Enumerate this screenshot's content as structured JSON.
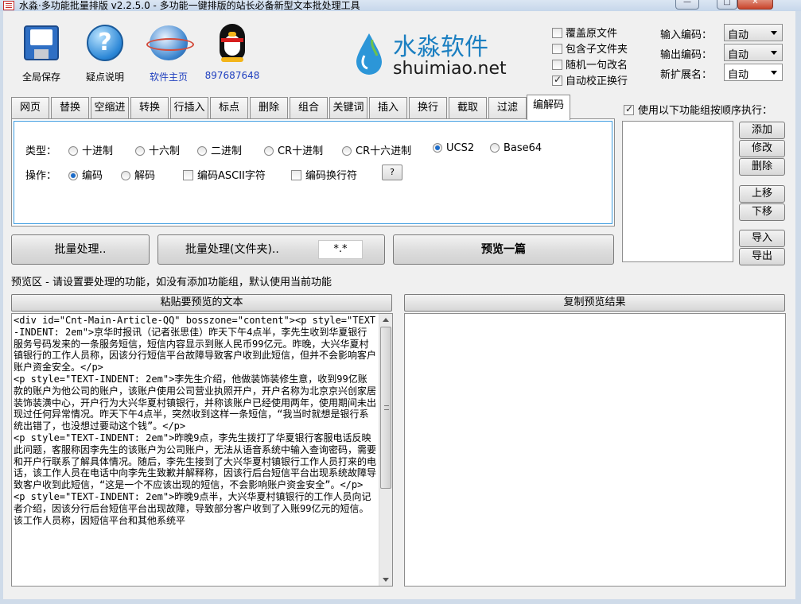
{
  "window": {
    "title": "水淼·多功能批量排版 v2.2.5.0 - 多功能一键排版的站长必备新型文本批处理工具"
  },
  "toolbar": [
    {
      "label": "全局保存",
      "icon": "floppy-disk-icon"
    },
    {
      "label": "疑点说明",
      "icon": "help-icon"
    },
    {
      "label": "软件主页",
      "icon": "globe-icon"
    },
    {
      "label": "897687648",
      "icon": "qq-penguin-icon"
    }
  ],
  "logo": {
    "brand": "水淼软件",
    "domain": "shuimiao.net"
  },
  "options": [
    {
      "label": "覆盖原文件",
      "checked": false
    },
    {
      "label": "包含子文件夹",
      "checked": false
    },
    {
      "label": "随机一句改名",
      "checked": false
    },
    {
      "label": "自动校正换行",
      "checked": true
    }
  ],
  "encoding": {
    "input_label": "输入编码：",
    "input_value": "自动",
    "output_label": "输出编码：",
    "output_value": "自动",
    "ext_label": "新扩展名：",
    "ext_value": "自动"
  },
  "tabs": [
    "网页",
    "替换",
    "空缩进",
    "转换",
    "行插入",
    "标点",
    "删除",
    "组合",
    "关键词",
    "插入",
    "换行",
    "截取",
    "过滤",
    "编解码"
  ],
  "active_tab": "编解码",
  "codec": {
    "type_label": "类型：",
    "types": [
      {
        "label": "十进制",
        "selected": false
      },
      {
        "label": "十六制",
        "selected": false
      },
      {
        "label": "二进制",
        "selected": false
      },
      {
        "label": "CR十进制",
        "selected": false
      },
      {
        "label": "CR十六进制",
        "selected": false
      },
      {
        "label": "UCS2",
        "selected": true
      },
      {
        "label": "Base64",
        "selected": false
      }
    ],
    "op_label": "操作：",
    "ops": [
      {
        "label": "编码",
        "selected": true
      },
      {
        "label": "解码",
        "selected": false
      }
    ],
    "checks": [
      {
        "label": "编码ASCII字符",
        "checked": false
      },
      {
        "label": "编码换行符",
        "checked": false
      }
    ],
    "help_button": "?"
  },
  "actions": {
    "batch": "批量处理..",
    "batch_folder": "批量处理(文件夹)..",
    "mask": "*.*",
    "preview": "预览一篇"
  },
  "sequence": {
    "header": "使用以下功能组按顺序执行：",
    "checked": true,
    "buttons": [
      "添加",
      "修改",
      "删除",
      "上移",
      "下移",
      "导入",
      "导出"
    ]
  },
  "preview": {
    "note": "预览区 - 请设置要处理的功能，如没有添加功能组，默认使用当前功能",
    "paste_button": "粘贴要预览的文本",
    "copy_button": "复制预览结果",
    "source_text": "<div id=\"Cnt-Main-Article-QQ\" bosszone=\"content\"><p style=\"TEXT-INDENT: 2em\">京华时报讯（记者张思佳）昨天下午4点半，李先生收到华夏银行服务号码发来的一条服务短信，短信内容显示到账人民币99亿元。昨晚，大兴华夏村镇银行的工作人员称，因该分行短信平台故障导致客户收到此短信，但并不会影响客户账户资金安全。</p>\n<p style=\"TEXT-INDENT: 2em\">李先生介绍，他做装饰装修生意，收到99亿账款的账户为他公司的账户，该账户使用公司营业执照开户，开户名称为北京京兴创家居装饰装潢中心，开户行为大兴华夏村镇银行，并称该账户已经使用两年，使用期间未出现过任何异常情况。昨天下午4点半，突然收到这样一条短信，“我当时就想是银行系统出错了，也没想过要动这个钱”。</p>\n<p style=\"TEXT-INDENT: 2em\">昨晚9点，李先生拨打了华夏银行客服电话反映此问题，客服称因李先生的该账户为公司账户，无法从语音系统中输入查询密码，需要和开户行联系了解具体情况。随后，李先生接到了大兴华夏村镇银行工作人员打来的电话，该工作人员在电话中向李先生致歉并解释称，因该行后台短信平台出现系统故障导致客户收到此短信，“这是一个不应该出现的短信，不会影响账户资金安全”。</p>\n<p style=\"TEXT-INDENT: 2em\">昨晚9点半，大兴华夏村镇银行的工作人员向记者介绍，因该分行后台短信平台出现故障，导致部分客户收到了入账99亿元的短信。该工作人员称，因短信平台和其他系统平"
  }
}
